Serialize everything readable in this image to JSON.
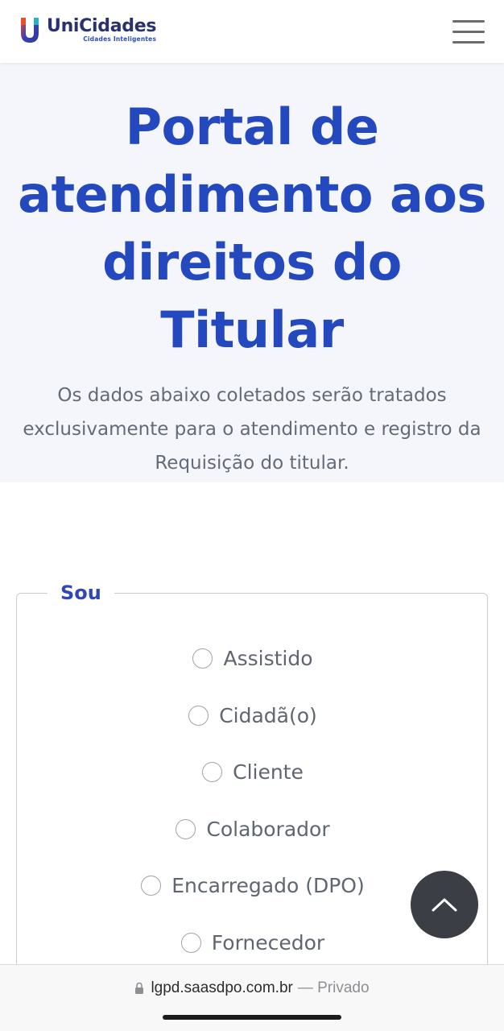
{
  "header": {
    "brand": "UniCidades",
    "tagline": "Cidades Inteligentes",
    "menu_icon": "hamburger-menu-icon"
  },
  "hero": {
    "title": "Portal de atendimento aos direitos do Titular",
    "subtitle": "Os dados abaixo coletados serão tratados exclusivamente para o atendimento e registro da Requisição do titular."
  },
  "form": {
    "legend": "Sou",
    "options": [
      "Assistido",
      "Cidadã(o)",
      "Cliente",
      "Colaborador",
      "Encarregado (DPO)",
      "Fornecedor"
    ]
  },
  "scroll_top": {
    "icon": "chevron-up-icon"
  },
  "browser": {
    "host": "lgpd.saasdpo.com.br",
    "mode": "— Privado",
    "lock_icon": "lock-icon"
  },
  "colors": {
    "accent": "#2448bd",
    "hero_bg": "#f4f6fb",
    "text_muted": "#646b76",
    "scroll_btn": "#3b3f45"
  }
}
